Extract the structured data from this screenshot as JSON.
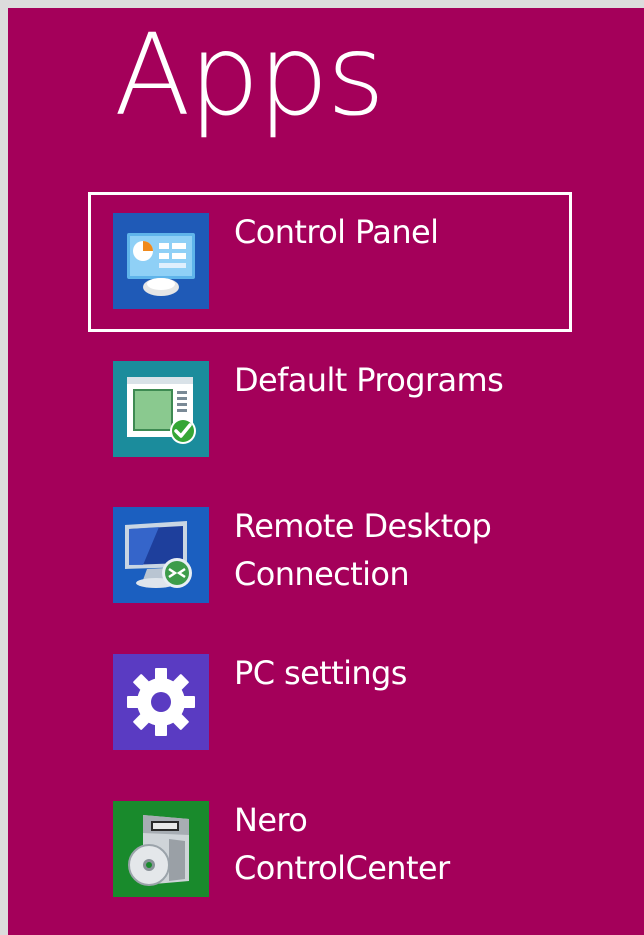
{
  "header": {
    "title": "Apps"
  },
  "apps": [
    {
      "lines": [
        "Control Panel"
      ],
      "icon": "control-panel-icon",
      "tile_color": "#1f5ab7",
      "selected": true
    },
    {
      "lines": [
        "Default Programs"
      ],
      "icon": "default-programs-icon",
      "tile_color": "#1b8c9c",
      "selected": false
    },
    {
      "lines": [
        "Remote Desktop",
        "Connection"
      ],
      "icon": "remote-desktop-icon",
      "tile_color": "#1b5fc0",
      "selected": false
    },
    {
      "lines": [
        "PC settings"
      ],
      "icon": "gear-icon",
      "tile_color": "#5a3bc2",
      "selected": false
    },
    {
      "lines": [
        "Nero",
        "ControlCenter"
      ],
      "icon": "nero-controlcenter-icon",
      "tile_color": "#198a2c",
      "selected": false
    }
  ],
  "colors": {
    "background": "#a4005a",
    "frame": "#dcdcdc",
    "text": "#ffffff",
    "selection_border": "#ffffff"
  }
}
